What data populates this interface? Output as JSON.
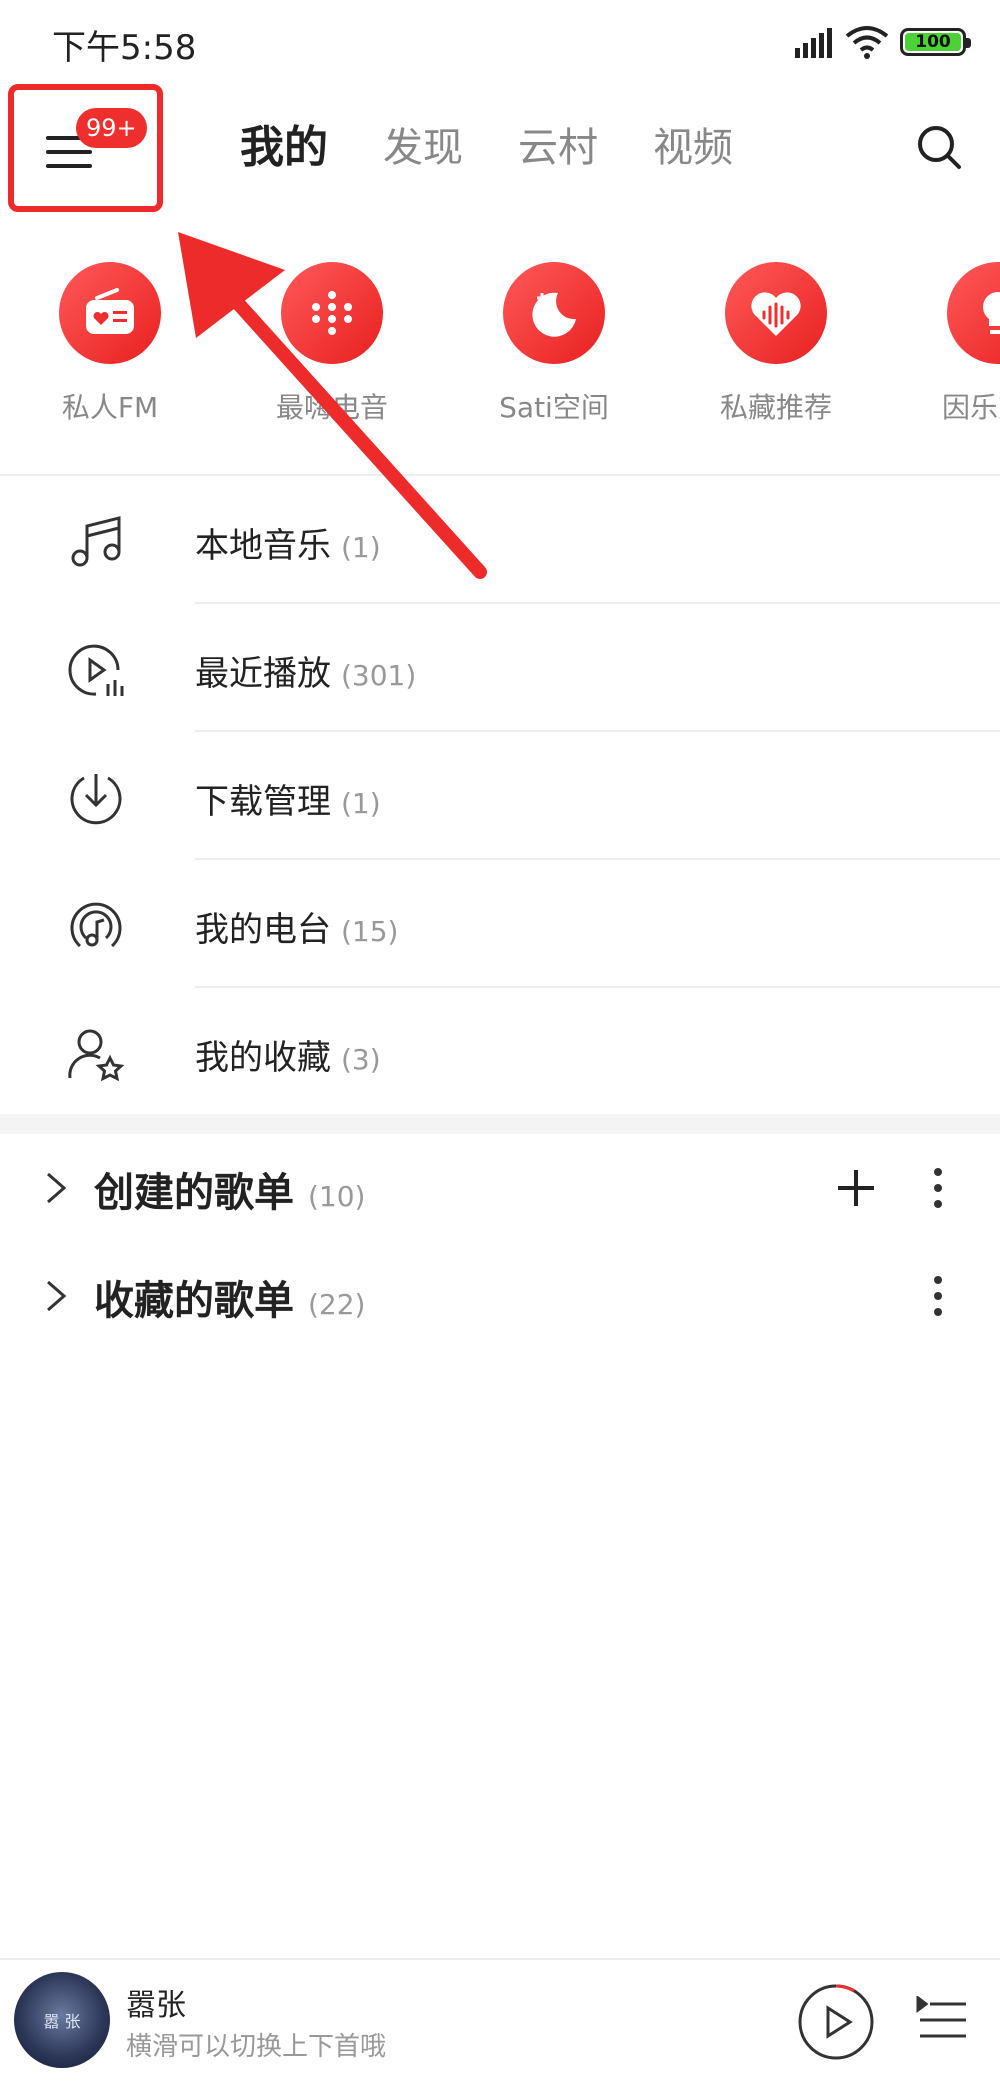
{
  "status_bar": {
    "time": "下午5:58",
    "battery": "100"
  },
  "top_nav": {
    "badge": "99+",
    "tabs": [
      {
        "label": "我的",
        "active": true
      },
      {
        "label": "发现",
        "active": false
      },
      {
        "label": "云村",
        "active": false
      },
      {
        "label": "视频",
        "active": false
      }
    ]
  },
  "quick_entries": [
    {
      "label": "私人FM",
      "icon": "radio-icon"
    },
    {
      "label": "最嗨电音",
      "icon": "dots-grid-icon"
    },
    {
      "label": "Sati空间",
      "icon": "moon-icon"
    },
    {
      "label": "私藏推荐",
      "icon": "heart-wave-icon"
    },
    {
      "label": "因乐交友",
      "icon": "bulb-icon"
    }
  ],
  "library": [
    {
      "label": "本地音乐",
      "count": "(1)",
      "icon": "music-note-icon"
    },
    {
      "label": "最近播放",
      "count": "(301)",
      "icon": "recent-play-icon"
    },
    {
      "label": "下载管理",
      "count": "(1)",
      "icon": "download-icon"
    },
    {
      "label": "我的电台",
      "count": "(15)",
      "icon": "podcast-icon"
    },
    {
      "label": "我的收藏",
      "count": "(3)",
      "icon": "user-star-icon"
    }
  ],
  "playlists": {
    "created": {
      "label": "创建的歌单",
      "count": "(10)"
    },
    "collected": {
      "label": "收藏的歌单",
      "count": "(22)"
    }
  },
  "mini_player": {
    "title": "嚣张",
    "subtitle": "横滑可以切换上下首哦",
    "art_text": "嚣 张"
  },
  "colors": {
    "accent": "#ef2e2e",
    "annotation": "#ee2b2b"
  }
}
